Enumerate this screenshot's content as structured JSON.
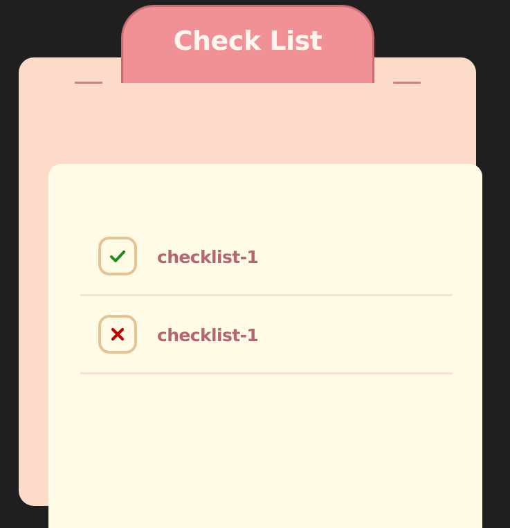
{
  "card": {
    "title": "Check List"
  },
  "colors": {
    "background": "#1f1f1f",
    "board": "#fcdcc8",
    "tab": "#f09196",
    "tab_border": "#c96c74",
    "content": "#fffbe7",
    "box_border": "#e5c394",
    "label": "#b5666c",
    "check": "#1a8f1a",
    "cross": "#c00000",
    "divider": "#fbe0cc"
  },
  "items": [
    {
      "label": "checklist-1",
      "state": "checked",
      "icon": "check-icon"
    },
    {
      "label": "checklist-1",
      "state": "unchecked",
      "icon": "cross-icon"
    }
  ]
}
